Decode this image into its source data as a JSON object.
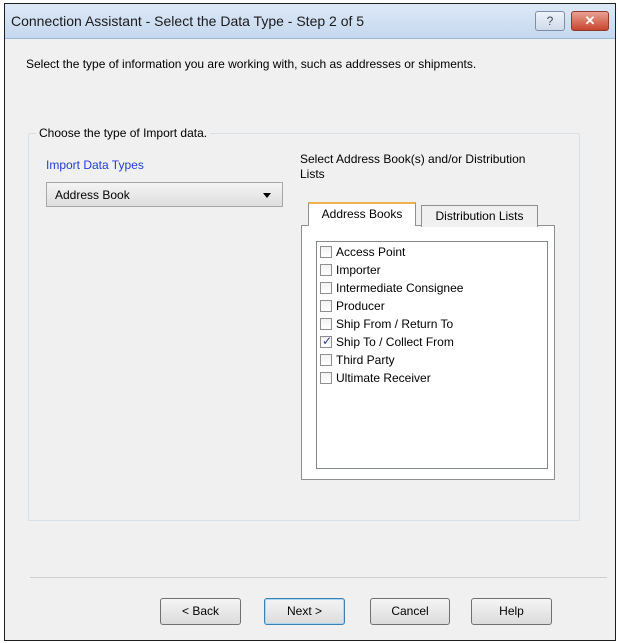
{
  "window": {
    "title": "Connection Assistant - Select the Data Type - Step 2 of 5",
    "help_icon": "question-icon",
    "close_icon": "close-icon"
  },
  "intro": "Select the type of information you are working with, such as addresses or shipments.",
  "group": {
    "legend": "Choose the type of Import data.",
    "import_label": "Import Data Types",
    "import_selected": "Address Book",
    "select_label": "Select Address Book(s) and/or Distribution Lists"
  },
  "tabs": [
    "Address Books",
    "Distribution Lists"
  ],
  "address_books": [
    {
      "label": "Access Point",
      "checked": false
    },
    {
      "label": "Importer",
      "checked": false
    },
    {
      "label": "Intermediate Consignee",
      "checked": false
    },
    {
      "label": "Producer",
      "checked": false
    },
    {
      "label": "Ship From / Return To",
      "checked": false
    },
    {
      "label": "Ship To / Collect From",
      "checked": true
    },
    {
      "label": "Third Party",
      "checked": false
    },
    {
      "label": "Ultimate Receiver",
      "checked": false
    }
  ],
  "buttons": {
    "back": "< Back",
    "next": "Next >",
    "cancel": "Cancel",
    "help": "Help"
  }
}
